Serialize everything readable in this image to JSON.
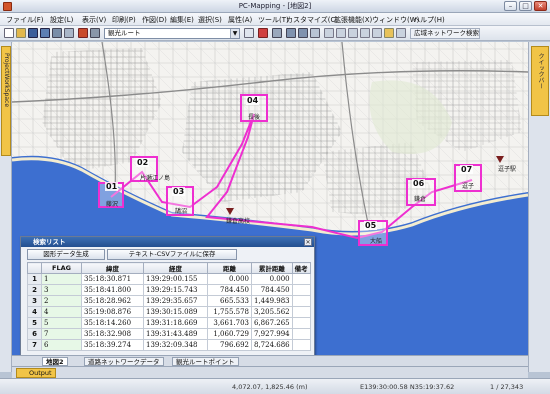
{
  "window": {
    "title": "PC-Mapping - [地図2]"
  },
  "menu": [
    "ファイル(F)",
    "設定(L)",
    "表示(V)",
    "印刷(P)",
    "作図(D)",
    "編集(E)",
    "選択(S)",
    "属性(A)",
    "ツール(T)",
    "カスタマイズ(C)",
    "拡張機能(X)",
    "ウィンドウ(W)",
    "ヘルプ(H)"
  ],
  "toolbar": {
    "layer_combo": "観光ルート",
    "network_combo": "広域ネットワーク検索"
  },
  "left_panel": {
    "tab_label": "ProjectWorkSpace"
  },
  "right_panel": {
    "tab_label": "クイックバー"
  },
  "map": {
    "markers": [
      {
        "num": "01",
        "place": "藤沢"
      },
      {
        "num": "02",
        "place": "片瀬江ノ島"
      },
      {
        "num": "03",
        "place": "鵠沼"
      },
      {
        "num": "04",
        "place": "長後"
      },
      {
        "num": "05",
        "place": "大船"
      },
      {
        "num": "06",
        "place": "鎌倉"
      },
      {
        "num": "07",
        "place": "逗子"
      }
    ],
    "extra_labels": [
      "鎌倉高校",
      "逗子駅"
    ],
    "colors": {
      "route": "#ee2fd0",
      "sea": "#3d6fd0",
      "pin": "#7a1f1f"
    }
  },
  "panel": {
    "title": "検索リスト",
    "btn_create": "図形データ生成",
    "btn_save": "テキスト-CSVファイルに保存",
    "columns": [
      "",
      "FLAG",
      "緯度",
      "経度",
      "距離",
      "累計距離",
      "備考"
    ],
    "rows": [
      [
        "1",
        "1",
        "35:18:30.871",
        "139:29:00.155",
        "0.000",
        "0.000",
        ""
      ],
      [
        "2",
        "3",
        "35:18:41.800",
        "139:29:15.743",
        "784.450",
        "784.450",
        ""
      ],
      [
        "3",
        "2",
        "35:18:28.962",
        "139:29:35.657",
        "665.533",
        "1,449.983",
        ""
      ],
      [
        "4",
        "4",
        "35:19:08.876",
        "139:30:15.089",
        "1,755.578",
        "3,205.562",
        ""
      ],
      [
        "5",
        "5",
        "35:18:14.260",
        "139:31:18.669",
        "3,661.703",
        "6,867.265",
        ""
      ],
      [
        "6",
        "7",
        "35:18:32.908",
        "139:31:43.489",
        "1,060.729",
        "7,927.994",
        ""
      ],
      [
        "7",
        "6",
        "35:18:39.274",
        "139:32:09.348",
        "796.692",
        "8,724.686",
        ""
      ]
    ]
  },
  "bottom_tabs": [
    "地図2",
    "道路ネットワークデータ",
    "観光ルートポイント"
  ],
  "output_tab": "Output",
  "status": {
    "coords": "4,072.07, 1,825.46 (m)",
    "latlon": "E139:30:00.58 N35:19:37.62",
    "page": "1 / 27,343"
  }
}
